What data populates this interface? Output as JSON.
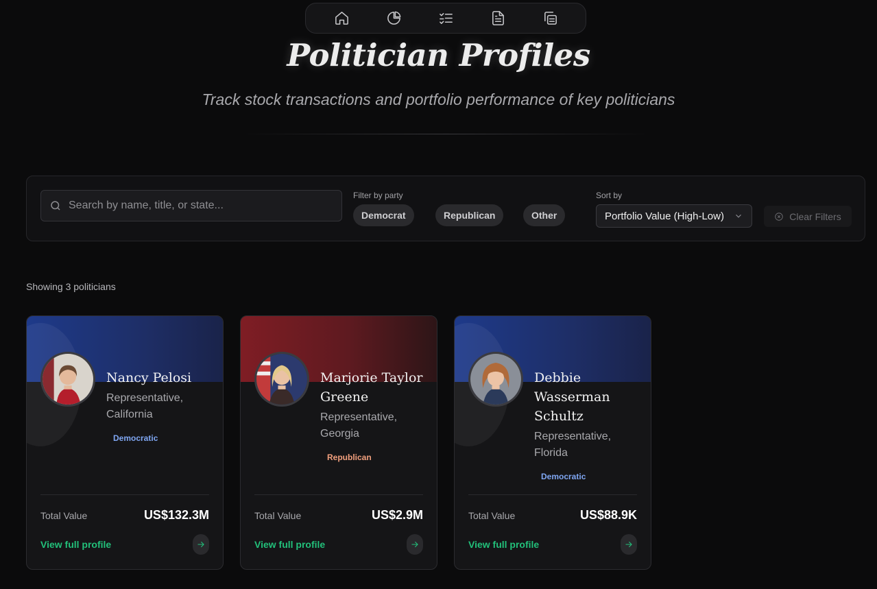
{
  "nav": {
    "items": [
      {
        "icon": "home-icon"
      },
      {
        "icon": "pie-chart-icon"
      },
      {
        "icon": "checklist-icon"
      },
      {
        "icon": "document-icon"
      },
      {
        "icon": "copy-icon"
      }
    ]
  },
  "header": {
    "title": "Politician Profiles",
    "subtitle": "Track stock transactions and portfolio performance of key politicians"
  },
  "filters": {
    "search_placeholder": "Search by name, title, or state...",
    "party_label": "Filter by party",
    "parties": [
      "Democrat",
      "Republican",
      "Other"
    ],
    "sort_label": "Sort by",
    "sort_value": "Portfolio Value (High-Low)",
    "clear_label": "Clear Filters"
  },
  "results": {
    "showing": "Showing 3 politicians"
  },
  "colors": {
    "democrat_banner": "#1e3a8a",
    "republican_banner": "#7f1d24",
    "link": "#22c07a",
    "democrat_text": "#7fa6f2",
    "republican_text": "#f2a07e"
  },
  "cards": [
    {
      "name": "Nancy Pelosi",
      "title": "Representative, California",
      "party": "Democratic",
      "total_label": "Total Value",
      "total_value": "US$132.3M",
      "link": "View full profile"
    },
    {
      "name": "Marjorie Taylor Greene",
      "title": "Representative, Georgia",
      "party": "Republican",
      "total_label": "Total Value",
      "total_value": "US$2.9M",
      "link": "View full profile"
    },
    {
      "name": "Debbie Wasserman Schultz",
      "title": "Representative, Florida",
      "party": "Democratic",
      "total_label": "Total Value",
      "total_value": "US$88.9K",
      "link": "View full profile"
    }
  ]
}
